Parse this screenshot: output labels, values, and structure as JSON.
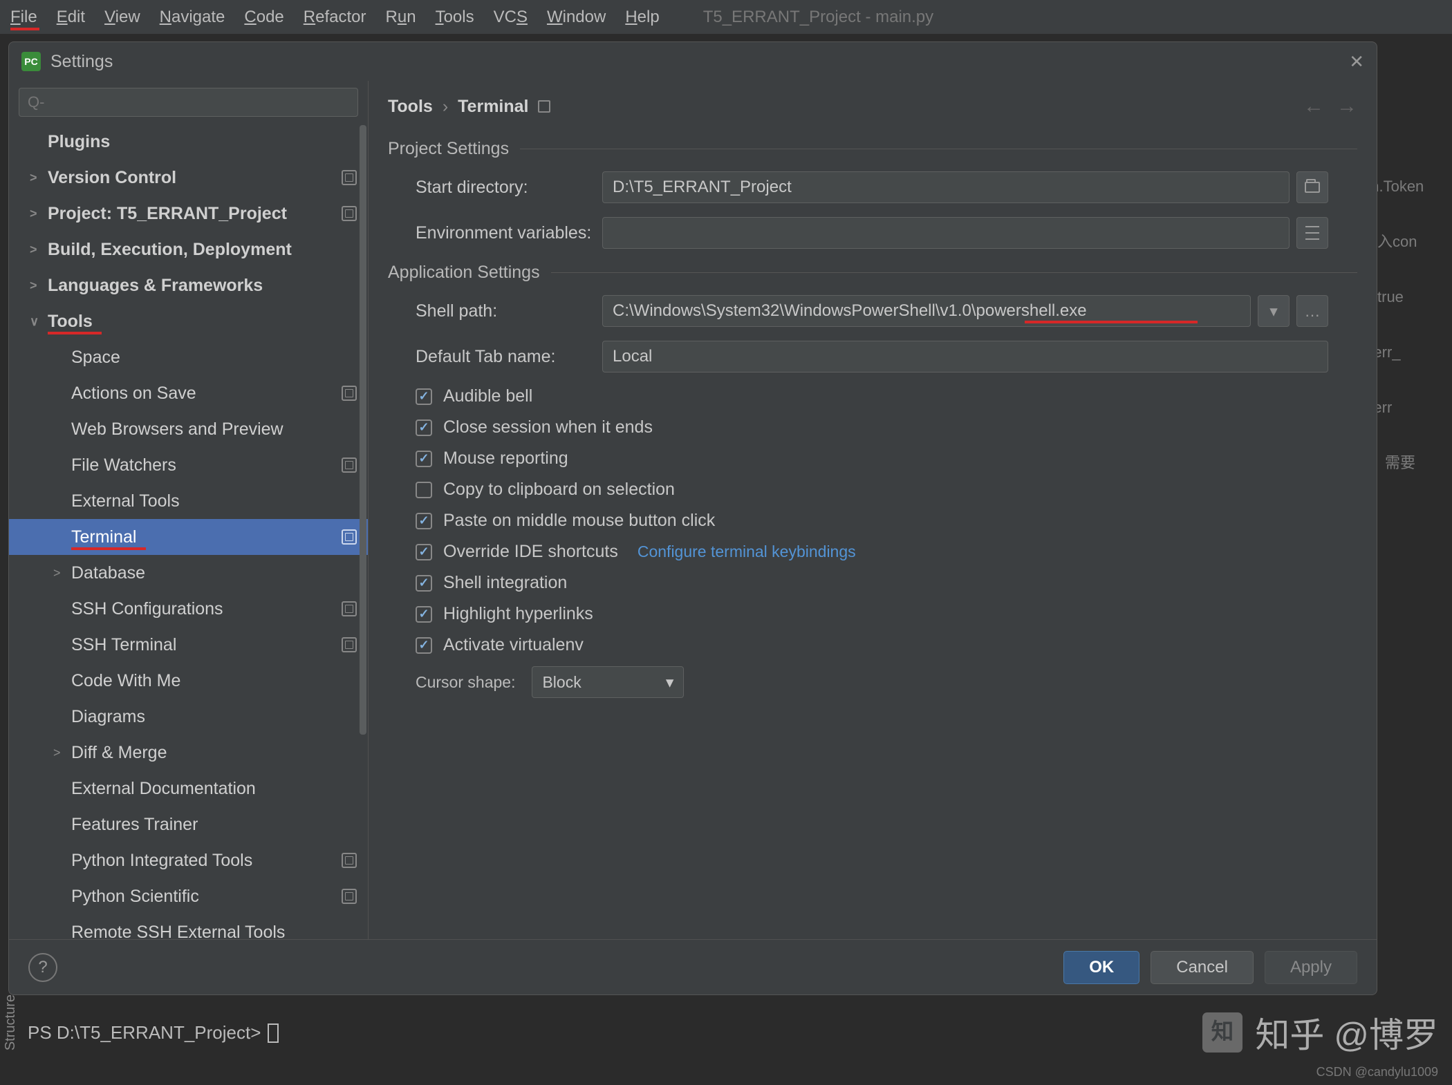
{
  "menu": {
    "items": [
      "File",
      "Edit",
      "View",
      "Navigate",
      "Code",
      "Refactor",
      "Run",
      "Tools",
      "VCS",
      "Window",
      "Help"
    ],
    "title": "T5_ERRANT_Project - main.py"
  },
  "dialog": {
    "title": "Settings",
    "search_placeholder": "Q-"
  },
  "sidebar": {
    "items": [
      {
        "label": "Plugins",
        "bold": true,
        "lvl": 0
      },
      {
        "label": "Version Control",
        "bold": true,
        "lvl": 0,
        "chev": ">",
        "gear": true
      },
      {
        "label": "Project: T5_ERRANT_Project",
        "bold": true,
        "lvl": 0,
        "chev": ">",
        "gear": true
      },
      {
        "label": "Build, Execution, Deployment",
        "bold": true,
        "lvl": 0,
        "chev": ">"
      },
      {
        "label": "Languages & Frameworks",
        "bold": true,
        "lvl": 0,
        "chev": ">"
      },
      {
        "label": "Tools",
        "bold": true,
        "lvl": 0,
        "chev": "∨",
        "red": true,
        "redw": 78
      },
      {
        "label": "Space",
        "lvl": 1
      },
      {
        "label": "Actions on Save",
        "lvl": 1,
        "gear": true
      },
      {
        "label": "Web Browsers and Preview",
        "lvl": 1
      },
      {
        "label": "File Watchers",
        "lvl": 1,
        "gear": true
      },
      {
        "label": "External Tools",
        "lvl": 1
      },
      {
        "label": "Terminal",
        "lvl": 1,
        "sel": true,
        "gear": true,
        "red": true,
        "redw": 108
      },
      {
        "label": "Database",
        "lvl": 1,
        "chev": ">"
      },
      {
        "label": "SSH Configurations",
        "lvl": 1,
        "gear": true
      },
      {
        "label": "SSH Terminal",
        "lvl": 1,
        "gear": true
      },
      {
        "label": "Code With Me",
        "lvl": 1
      },
      {
        "label": "Diagrams",
        "lvl": 1
      },
      {
        "label": "Diff & Merge",
        "lvl": 1,
        "chev": ">"
      },
      {
        "label": "External Documentation",
        "lvl": 1
      },
      {
        "label": "Features Trainer",
        "lvl": 1
      },
      {
        "label": "Python Integrated Tools",
        "lvl": 1,
        "gear": true
      },
      {
        "label": "Python Scientific",
        "lvl": 1,
        "gear": true
      },
      {
        "label": "Remote SSH External Tools",
        "lvl": 1
      }
    ]
  },
  "crumb": {
    "root": "Tools",
    "leaf": "Terminal"
  },
  "project": {
    "title": "Project Settings",
    "start_dir_label": "Start directory:",
    "start_dir": "D:\\T5_ERRANT_Project",
    "env_label": "Environment variables:",
    "env": ""
  },
  "app": {
    "title": "Application Settings",
    "shell_label": "Shell path:",
    "shell": "C:\\Windows\\System32\\WindowsPowerShell\\v1.0\\powershell.exe",
    "tab_label": "Default Tab name:",
    "tab": "Local",
    "checks": [
      {
        "label": "Audible bell",
        "on": true
      },
      {
        "label": "Close session when it ends",
        "on": true
      },
      {
        "label": "Mouse reporting",
        "on": true
      },
      {
        "label": "Copy to clipboard on selection",
        "on": false
      },
      {
        "label": "Paste on middle mouse button click",
        "on": true
      },
      {
        "label": "Override IDE shortcuts",
        "on": true,
        "link": "Configure terminal keybindings"
      },
      {
        "label": "Shell integration",
        "on": true
      },
      {
        "label": "Highlight hyperlinks",
        "on": true
      },
      {
        "label": "Activate virtualenv",
        "on": true
      }
    ],
    "cursor_label": "Cursor shape:",
    "cursor_value": "Block"
  },
  "footer": {
    "ok": "OK",
    "cancel": "Cancel",
    "apply": "Apply"
  },
  "terminal_prompt": "PS D:\\T5_ERRANT_Project>",
  "bg_code": [
    "en.Token",
    "放入con",
    "为true",
    ", 'err_",
    ", 'err",
    "y，需要"
  ],
  "watermark": "知乎 @博罗",
  "csdn": "CSDN @candylu1009",
  "side_tab": "Structure"
}
